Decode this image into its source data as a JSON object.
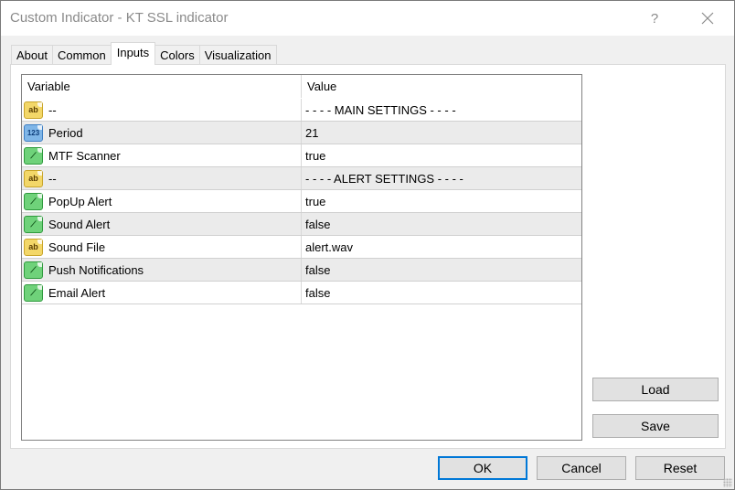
{
  "window": {
    "title": "Custom Indicator - KT SSL indicator",
    "help_label": "?",
    "close_label": "✕"
  },
  "tabs": [
    {
      "label": "About",
      "active": false
    },
    {
      "label": "Common",
      "active": false
    },
    {
      "label": "Inputs",
      "active": true
    },
    {
      "label": "Colors",
      "active": false
    },
    {
      "label": "Visualization",
      "active": false
    }
  ],
  "inputs_table": {
    "columns": [
      "Variable",
      "Value"
    ],
    "rows": [
      {
        "icon": "string-icon",
        "icon_text": "ab",
        "variable": "--",
        "value": "- - - - MAIN SETTINGS - - - -"
      },
      {
        "icon": "integer-icon",
        "icon_text": "123",
        "variable": "Period",
        "value": "21"
      },
      {
        "icon": "boolean-icon",
        "icon_text": "⟋",
        "variable": "MTF Scanner",
        "value": "true"
      },
      {
        "icon": "string-icon",
        "icon_text": "ab",
        "variable": "--",
        "value": "- - - - ALERT SETTINGS - - - -"
      },
      {
        "icon": "boolean-icon",
        "icon_text": "⟋",
        "variable": "PopUp Alert",
        "value": "true"
      },
      {
        "icon": "boolean-icon",
        "icon_text": "⟋",
        "variable": "Sound Alert",
        "value": "false"
      },
      {
        "icon": "string-icon",
        "icon_text": "ab",
        "variable": "Sound File",
        "value": "alert.wav"
      },
      {
        "icon": "boolean-icon",
        "icon_text": "⟋",
        "variable": "Push Notifications",
        "value": "false"
      },
      {
        "icon": "boolean-icon",
        "icon_text": "⟋",
        "variable": "Email Alert",
        "value": "false"
      }
    ]
  },
  "side_buttons": {
    "load": "Load",
    "save": "Save"
  },
  "bottom_buttons": {
    "ok": "OK",
    "cancel": "Cancel",
    "reset": "Reset"
  }
}
